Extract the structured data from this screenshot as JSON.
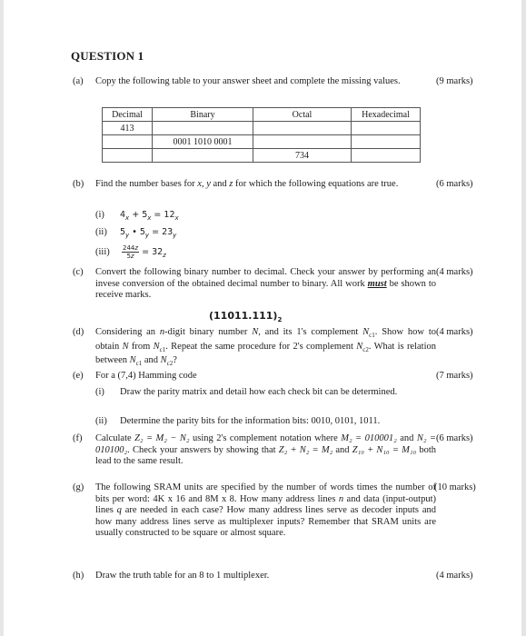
{
  "title": "QUESTION 1",
  "questions": {
    "a": {
      "label": "(a)",
      "text": "Copy the following table to your answer sheet and complete the missing values.",
      "marks": "(9 marks)",
      "table": {
        "headers": [
          "Decimal",
          "Binary",
          "Octal",
          "Hexadecimal"
        ],
        "rows": [
          [
            "413",
            "",
            "",
            ""
          ],
          [
            "",
            "0001 1010 0001",
            "",
            ""
          ],
          [
            "",
            "",
            "734",
            ""
          ]
        ]
      }
    },
    "b": {
      "label": "(b)",
      "text_pre": "Find the number bases for ",
      "var_x": "x",
      "sep1": ", ",
      "var_y": "y",
      "and": " and ",
      "var_z": "z",
      "text_post": " for which the following equations are true.",
      "marks": "(6 marks)",
      "items": [
        {
          "label": "(i)",
          "lhs1": "4",
          "sub1": "x",
          "op": " + ",
          "lhs2": "5",
          "sub2": "x",
          "eq": " = ",
          "rhs": "12",
          "sub3": "x"
        },
        {
          "label": "(ii)",
          "lhs1": "5",
          "sub1": "y",
          "op": " • ",
          "lhs2": "5",
          "sub2": "y",
          "eq": " = ",
          "rhs": "23",
          "sub3": "y"
        },
        {
          "label": "(iii)",
          "num": "244",
          "numsub": "z",
          "den": "5",
          "densub": "z",
          "eq": " = ",
          "rhs": "32",
          "sub3": "z"
        }
      ]
    },
    "c": {
      "label": "(c)",
      "text1": "Convert the following binary number to decimal. Check your answer by performing an invese conversion of the obtained decimal number to binary. All work ",
      "must": "must",
      "text2": " be shown to receive marks.",
      "marks": "(4 marks)",
      "expr": "(11011.111)",
      "expr_sub": "2"
    },
    "d": {
      "label": "(d)",
      "t1": "Considering an ",
      "n": "n",
      "t2": "-digit binary number ",
      "N": "N",
      "t3": ", and its 1's complement ",
      "Nc1": "N",
      "c1": "c1",
      "t4": ". Show how to obtain ",
      "t5": " from ",
      "t6": ". Repeat the same procedure for 2's complement ",
      "c2": "c2",
      "t7": ". What is relation between ",
      "t8": " and ",
      "t9": "?",
      "marks": "(4 marks)"
    },
    "e": {
      "label": "(e)",
      "text": "For a (7,4) Hamming code",
      "marks": "(7 marks)",
      "items": [
        {
          "label": "(i)",
          "text": "Draw the parity matrix and detail how each check bit can be determined."
        },
        {
          "label": "(ii)",
          "text": "Determine the parity bits for the information bits: 0010, 0101, 1011."
        }
      ]
    },
    "f": {
      "label": "(f)",
      "t1": "Calculate ",
      "eq1": "Z₂ = M₂ − N₂",
      "t2": " using 2's complement notation where ",
      "eq2": "M₂ = 010001₂",
      "t3": " and ",
      "eq3": "N₂ = 010100₂",
      "t4": ". Check your answers by showing that ",
      "eq4": "Z₂ + N₂ = M₂",
      "t5": " and ",
      "eq5": "Z₁₀ + N₁₀ = M₁₀",
      "t6": " both lead to the same result.",
      "marks": "(6 marks)"
    },
    "g": {
      "label": "(g)",
      "t1": "The following SRAM units are specified by the number of words times the number of bits per word: 4K x 16 and 8M x 8. How many address lines ",
      "n": "n",
      "t2": " and data (input-output) lines ",
      "q": "q",
      "t3": " are needed in each case? How many address lines serve as decoder inputs and how many address lines serve as multiplexer inputs? Remember that SRAM units are usually constructed to be square or almost square.",
      "marks": "(10 marks)"
    },
    "h": {
      "label": "(h)",
      "text": "Draw the truth table for an 8 to 1 multiplexer.",
      "marks": "(4 marks)"
    }
  }
}
